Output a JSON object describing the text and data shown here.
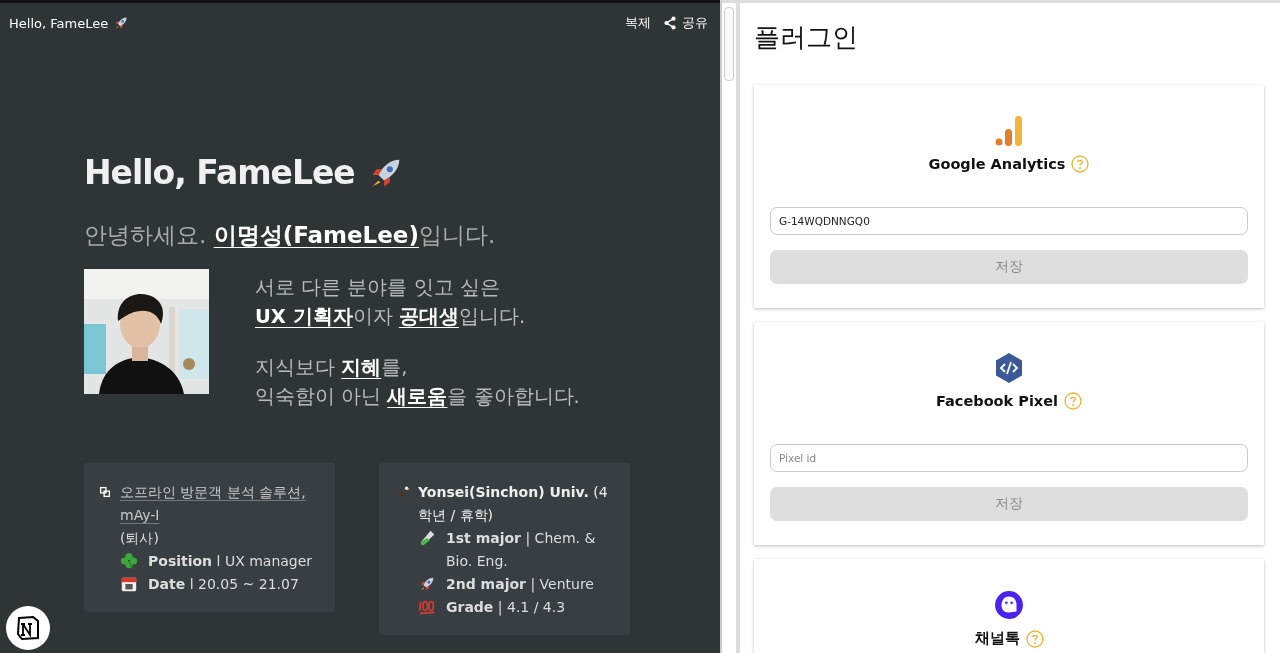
{
  "topbar": {
    "title": "Hello, FameLee",
    "actions": [
      {
        "kind": "text",
        "label": "복제"
      },
      {
        "kind": "share",
        "label": "공유"
      }
    ]
  },
  "page": {
    "title": "Hello, FameLee",
    "greeting": "안녕하세요. **이명성(FameLee)**입니다.",
    "photo": {
      "kind": "picture"
    },
    "intro": [
      [
        "서로 다른 분야를 잇고 싶은",
        "**UX 기획자**이자 **공대생**입니다."
      ],
      [
        "지식보다 **지혜**를,",
        "익숙함이 아닌 **새로움**을 좋아합니다."
      ]
    ],
    "cards": [
      {
        "kind": "work",
        "link": "오프라인 방문객 분석 솔루션, mAy-I",
        "note": "(퇴사)",
        "lines": [
          {
            "text": "**Position** l UX manager"
          },
          {
            "text": "**Date** l 20.05 ~ 21.07"
          }
        ]
      },
      {
        "kind": "school",
        "heading": "**Yonsei(Sinchon) Univ.** (4학년 / 휴학)",
        "lines": [
          {
            "text": "**1st major** | Chem. & Bio. Eng."
          },
          {
            "text": "**2nd major** | Venture"
          },
          {
            "text": "**Grade** | 4.1 / 4.3"
          }
        ]
      }
    ]
  },
  "plugins": {
    "title": "플러그인",
    "items": [
      {
        "kind": "analytics",
        "name": "Google Analytics",
        "value": "G-14WQDNNGQ0",
        "button": "저장",
        "disabled": true
      },
      {
        "kind": "pixel",
        "name": "Facebook Pixel",
        "placeholder": "Pixel id",
        "button": "저장",
        "disabled": true
      },
      {
        "kind": "channel",
        "name": "채널톡"
      }
    ]
  }
}
